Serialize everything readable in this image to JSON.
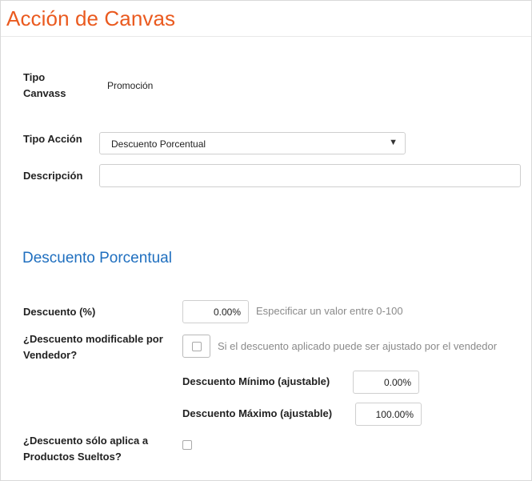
{
  "page": {
    "title": "Acción de Canvas"
  },
  "form": {
    "tipo_canvass_label_line1": "Tipo",
    "tipo_canvass_label_line2": "Canvass",
    "tipo_canvass_value": "Promoción",
    "tipo_accion_label": "Tipo Acción",
    "tipo_accion_selected": "Descuento Porcentual",
    "descripcion_label": "Descripción",
    "descripcion_value": ""
  },
  "section": {
    "title": "Descuento Porcentual",
    "descuento_label": "Descuento (%)",
    "descuento_value": "0.00%",
    "descuento_hint": "Especificar un valor entre 0-100",
    "modificable_label_line1": "¿Descuento modificable por",
    "modificable_label_line2": "Vendedor?",
    "modificable_checked": false,
    "modificable_hint": "Si el descuento aplicado puede ser ajustado por el vendedor",
    "minimo_label": "Descuento Mínimo (ajustable)",
    "minimo_value": "0.00%",
    "maximo_label": "Descuento Máximo (ajustable)",
    "maximo_value": "100.00%",
    "sueltos_label_line1": "¿Descuento sólo aplica a",
    "sueltos_label_line2": "Productos Sueltos?",
    "sueltos_checked": false
  },
  "icons": {
    "dropdown": "caret-down-icon"
  },
  "colors": {
    "title": "#ea5a1f",
    "section_title": "#1f6fbf",
    "hint": "#8a8a8a",
    "border": "#cfcfcf"
  }
}
